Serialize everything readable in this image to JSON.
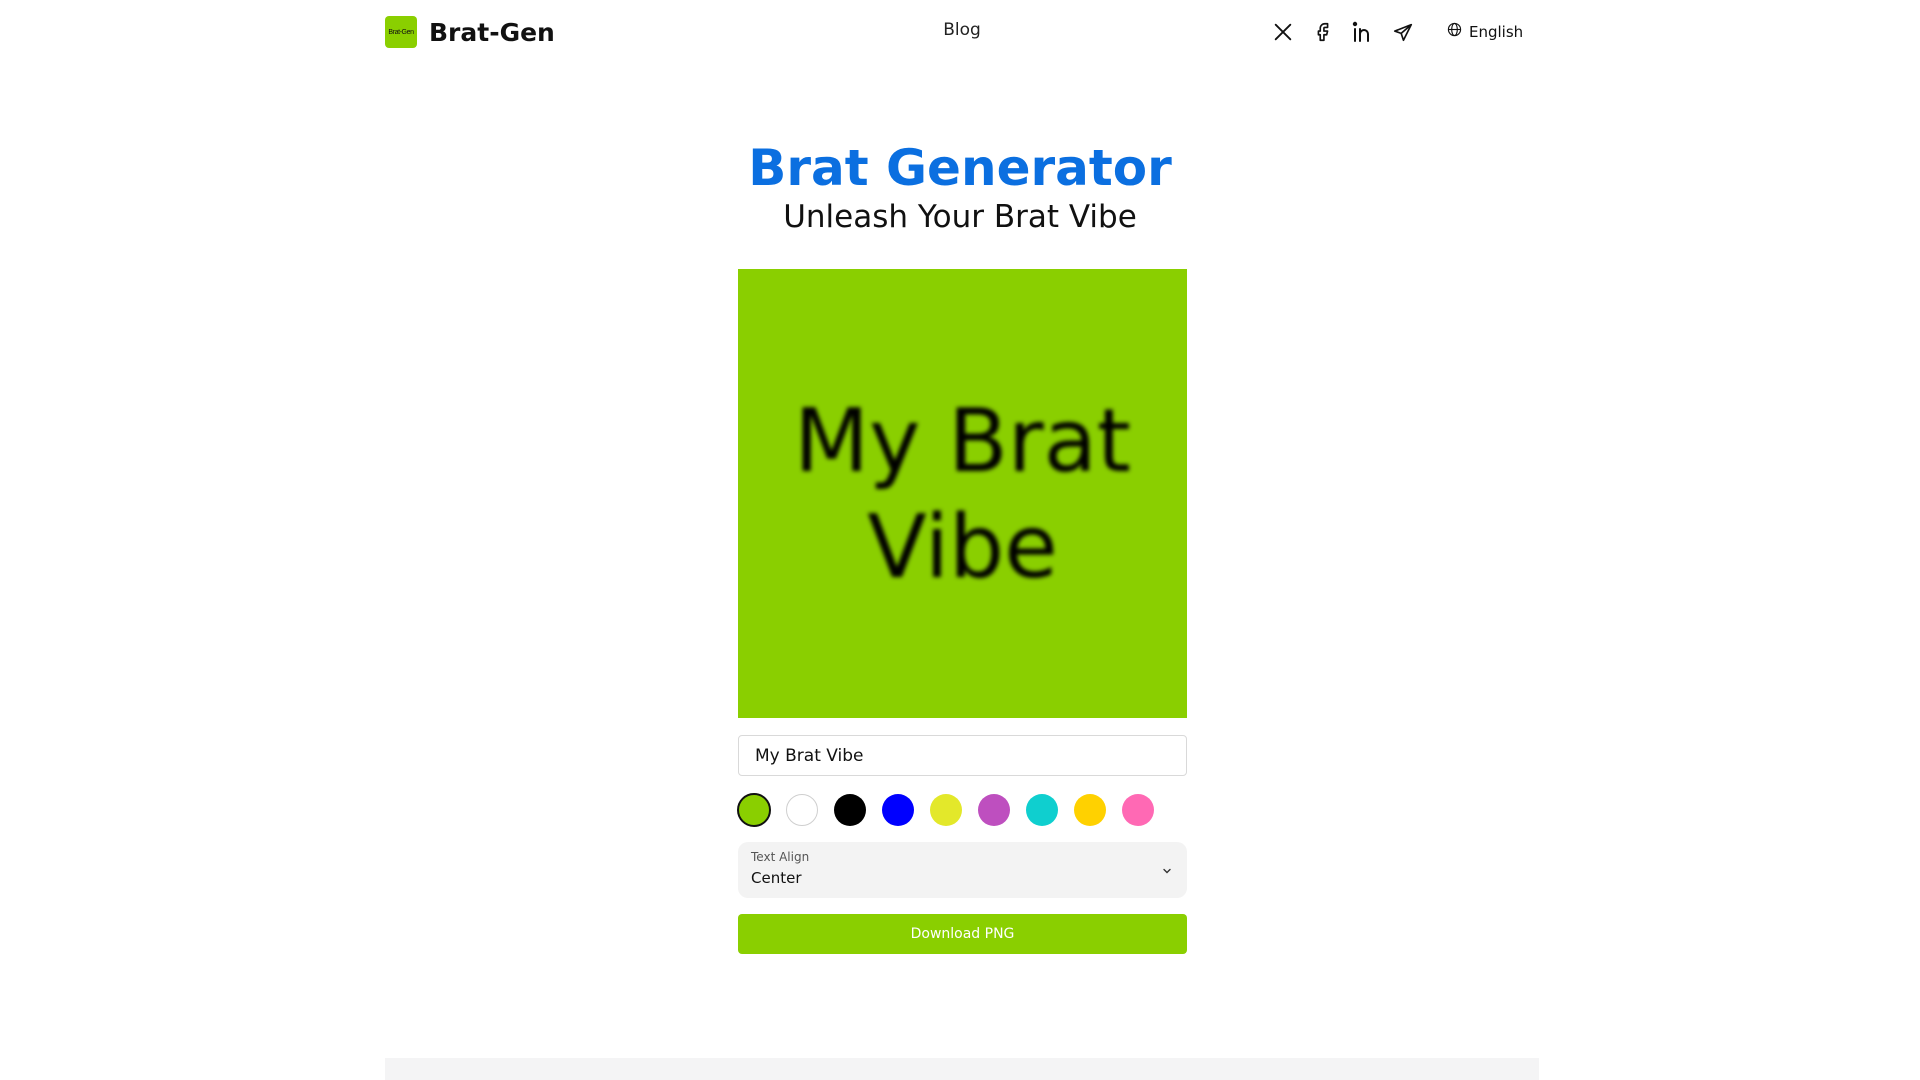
{
  "header": {
    "logo_text": "Brat-Gen",
    "brand_name": "Brat-Gen",
    "nav": {
      "blog_label": "Blog"
    },
    "social_icons": [
      "x-icon",
      "facebook-icon",
      "linkedin-icon",
      "telegram-icon"
    ],
    "language": {
      "icon": "globe-icon",
      "label": "English"
    }
  },
  "hero": {
    "title": "Brat Generator",
    "subtitle": "Unleash Your Brat Vibe"
  },
  "preview": {
    "text": "My Brat Vibe",
    "background_color": "#8acf00",
    "text_color": "#000000"
  },
  "editor": {
    "text_input_value": "My Brat Vibe",
    "colors": [
      "#8acf00",
      "#ffffff",
      "#000000",
      "#0000ff",
      "#e3e82a",
      "#be4fbf",
      "#0fcfcf",
      "#ffd100",
      "#ff69b4"
    ],
    "selected_color_index": 0,
    "text_align": {
      "label": "Text Align",
      "value": "Center"
    },
    "download_label": "Download PNG"
  },
  "colors": {
    "accent": "#8acf00",
    "title_blue": "#0b6fe0"
  }
}
